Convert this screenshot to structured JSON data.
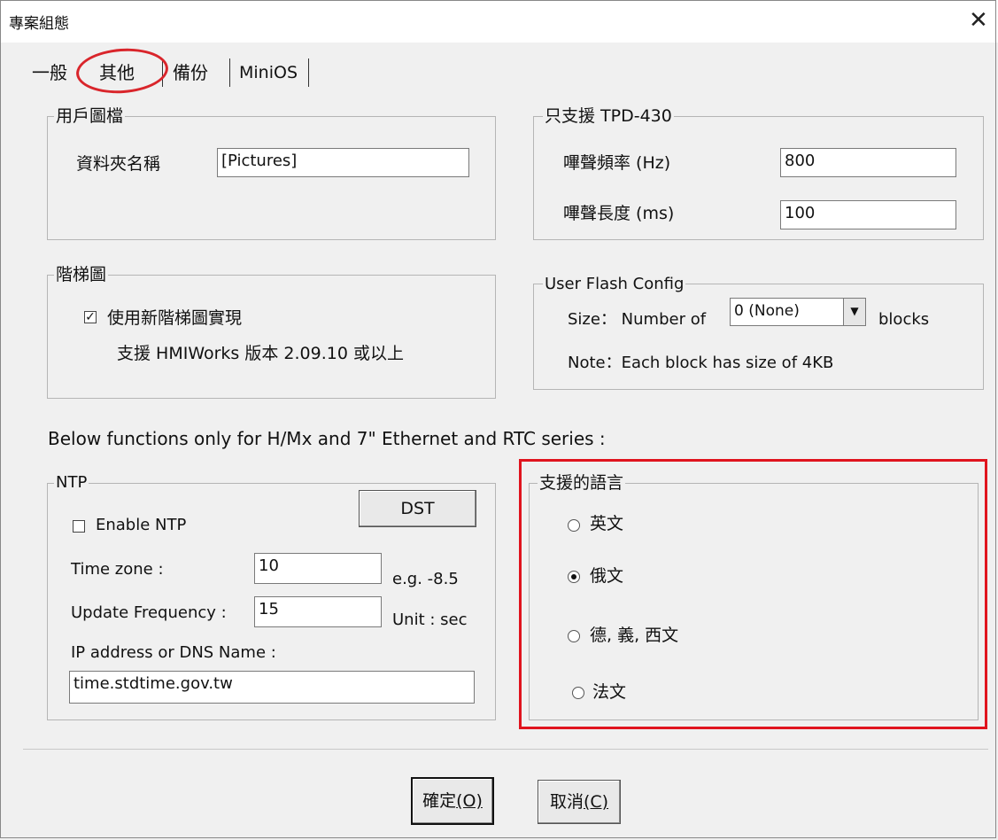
{
  "window": {
    "title": "專案組態",
    "close_glyph": "✕"
  },
  "tabs": [
    {
      "label": "一般"
    },
    {
      "label": "其他"
    },
    {
      "label": "備份"
    },
    {
      "label": "MiniOS"
    }
  ],
  "user_pictures": {
    "group_label": "用戶圖檔",
    "folder_label": "資料夾名稱",
    "folder_value": "[Pictures]"
  },
  "tpd430": {
    "group_label": "只支援 TPD-430",
    "beep_freq_label": "嗶聲頻率 (Hz)",
    "beep_freq_value": "800",
    "beep_len_label": "嗶聲長度 (ms)",
    "beep_len_value": "100"
  },
  "ladder": {
    "group_label": "階梯圖",
    "checkbox_label": "使用新階梯圖實現",
    "checkbox_checked": true,
    "note": "支援 HMIWorks 版本 2.09.10 或以上"
  },
  "user_flash": {
    "group_label": "User Flash Config",
    "size_label": "Size： Number of",
    "select_value": "0 (None)",
    "blocks_label": "blocks",
    "note": "Note：Each block has size of 4KB"
  },
  "below_note": "Below functions only for H/Mx and 7\" Ethernet and RTC series :",
  "ntp": {
    "group_label": "NTP",
    "dst_button": "DST",
    "enable_label": "Enable NTP",
    "enable_checked": false,
    "timezone_label": "Time zone :",
    "timezone_value": "10",
    "timezone_hint": "e.g. -8.5",
    "update_label": "Update Frequency :",
    "update_value": "15",
    "update_hint": "Unit : sec",
    "ip_label": "IP address or DNS Name :",
    "ip_value": "time.stdtime.gov.tw"
  },
  "languages": {
    "group_label": "支援的語言",
    "options": [
      {
        "label": "英文",
        "checked": false
      },
      {
        "label": "俄文",
        "checked": true
      },
      {
        "label": "德, 義, 西文",
        "checked": false
      },
      {
        "label": "法文",
        "checked": false
      }
    ]
  },
  "footer": {
    "ok_label": "確定",
    "ok_mnemonic": "(O)",
    "cancel_label": "取消",
    "cancel_mnemonic": "(C)"
  },
  "colors": {
    "highlight": "#e0141e",
    "dialog_bg": "#f0f0f0"
  }
}
